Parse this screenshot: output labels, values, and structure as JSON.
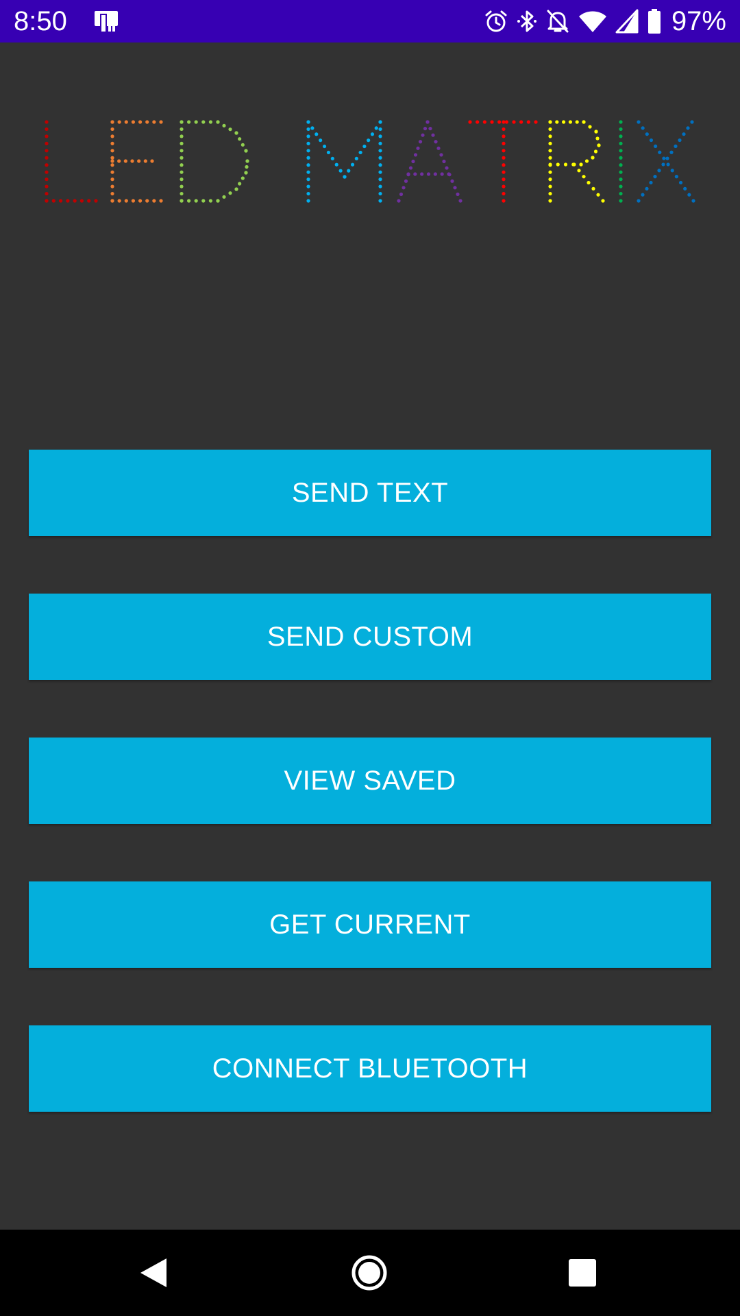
{
  "status_bar": {
    "time": "8:50",
    "battery": "97%",
    "icons": [
      "app-notification-icon",
      "alarm-icon",
      "bluetooth-icon",
      "notifications-off-icon",
      "wifi-icon",
      "cellular-signal-icon",
      "battery-icon"
    ]
  },
  "logo": {
    "text": "LED MATRIX",
    "letter_colors": {
      "L": "#c00000",
      "E": "#ed7d31",
      "D": "#92d050",
      "M": "#00b0f0",
      "A": "#7030a0",
      "T": "#ff0000",
      "R": "#ffff00",
      "I": "#00b050",
      "X": "#0070c0"
    }
  },
  "buttons": {
    "send_text": "SEND TEXT",
    "send_custom": "SEND CUSTOM",
    "view_saved": "VIEW SAVED",
    "get_current": "GET CURRENT",
    "connect_bluetooth": "CONNECT BLUETOOTH"
  },
  "colors": {
    "status_bar": "#3700b3",
    "background": "#323232",
    "button": "#04afdc",
    "button_text": "#ffffff",
    "nav_bar": "#000000"
  },
  "nav": {
    "icons": [
      "back-icon",
      "home-icon",
      "recents-icon"
    ]
  }
}
